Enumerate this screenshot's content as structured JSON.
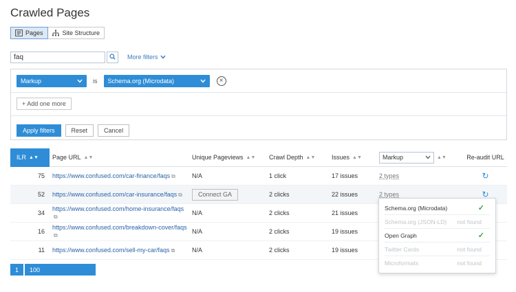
{
  "page": {
    "title": "Crawled Pages"
  },
  "view_toggle": {
    "pages_label": "Pages",
    "site_structure_label": "Site Structure"
  },
  "search": {
    "value": "faq",
    "more_filters_label": "More filters"
  },
  "filter": {
    "field_value": "Markup",
    "operator_label": "is",
    "condition_value": "Schema.org (Microdata)",
    "add_more_label": "+ Add one more",
    "apply_label": "Apply filters",
    "reset_label": "Reset",
    "cancel_label": "Cancel"
  },
  "table": {
    "headers": {
      "ilr": "ILR",
      "url": "Page URL",
      "pageviews": "Unique Pageviews",
      "crawl_depth": "Crawl Depth",
      "issues": "Issues",
      "markup_select": "Markup",
      "reaudit": "Re-audit URL"
    },
    "rows": [
      {
        "ilr": "75",
        "url": "https://www.confused.com/car-finance/faqs",
        "pageviews": "N/A",
        "crawl_depth": "1 click",
        "issues": "17 issues",
        "markup": "2 types"
      },
      {
        "ilr": "52",
        "url": "https://www.confused.com/car-insurance/faqs",
        "pageviews": "Connect GA",
        "crawl_depth": "2 clicks",
        "issues": "22 issues",
        "markup": "2 types"
      },
      {
        "ilr": "34",
        "url": "https://www.confused.com/home-insurance/faqs",
        "pageviews": "N/A",
        "crawl_depth": "2 clicks",
        "issues": "21 issues",
        "markup": ""
      },
      {
        "ilr": "16",
        "url": "https://www.confused.com/breakdown-cover/faqs",
        "pageviews": "N/A",
        "crawl_depth": "2 clicks",
        "issues": "19 issues",
        "markup": ""
      },
      {
        "ilr": "11",
        "url": "https://www.confused.com/sell-my-car/faqs",
        "pageviews": "N/A",
        "crawl_depth": "2 clicks",
        "issues": "19 issues",
        "markup": ""
      }
    ]
  },
  "markup_popup": {
    "items": [
      {
        "label": "Schema.org (Microdata)",
        "status": "found"
      },
      {
        "label": "Schema.org (JSON-LD)",
        "status": "not found"
      },
      {
        "label": "Open Graph",
        "status": "found"
      },
      {
        "label": "Twitter Cards",
        "status": "not found"
      },
      {
        "label": "Microformats",
        "status": "not found"
      }
    ]
  },
  "pagination": {
    "current_page": "1",
    "page_size": "100"
  },
  "colors": {
    "accent": "#2e8dd6",
    "link": "#2a63a8",
    "check": "#3aa641"
  }
}
